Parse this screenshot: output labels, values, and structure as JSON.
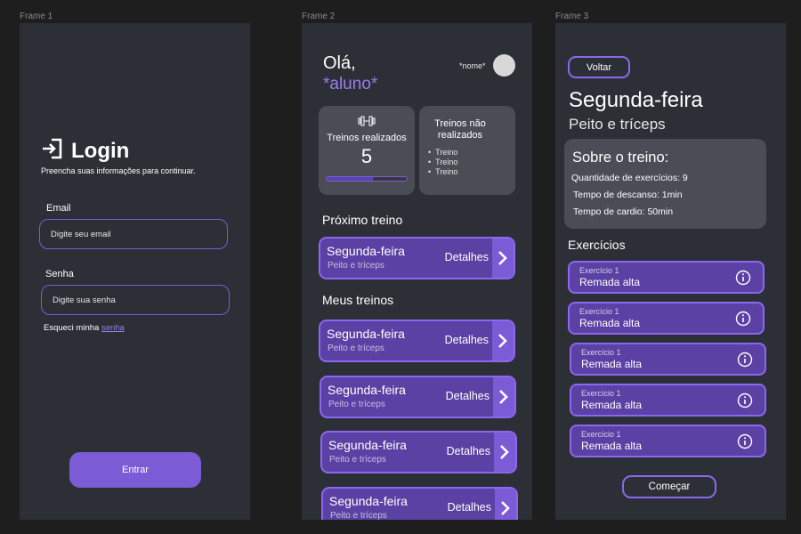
{
  "frames": [
    "Frame 1",
    "Frame 2",
    "Frame 3"
  ],
  "login": {
    "title": "Login",
    "subtitle": "Preencha suas informações para continuar.",
    "email_label": "Email",
    "email_placeholder": "Digite seu email",
    "password_label": "Senha",
    "password_placeholder": "Digite sua senha",
    "forgot_text": "Esqueci minha",
    "forgot_link": "senha",
    "submit": "Entrar"
  },
  "home": {
    "greeting": "Olá,",
    "student": "*aluno*",
    "user_name": "*nome*",
    "done_label": "Treinos realizados",
    "done_count": "5",
    "done_progress": 0.58,
    "missed_label": "Treinos não realizados",
    "missed_items": [
      "Treino",
      "Treino",
      "Treino"
    ],
    "next_title": "Próximo treino",
    "next_workout": {
      "title": "Segunda-feira",
      "subtitle": "Peito e tríceps",
      "action": "Detalhes"
    },
    "my_title": "Meus treinos",
    "workouts": [
      {
        "title": "Segunda-feira",
        "subtitle": "Peito e tríceps",
        "action": "Detalhes"
      },
      {
        "title": "Segunda-feira",
        "subtitle": "Peito e tríceps",
        "action": "Detalhes"
      },
      {
        "title": "Segunda-feira",
        "subtitle": "Peito e tríceps",
        "action": "Detalhes"
      },
      {
        "title": "Segunda-feira",
        "subtitle": "Peito e tríceps",
        "action": "Detalhes"
      }
    ]
  },
  "detail": {
    "back": "Voltar",
    "day": "Segunda-feira",
    "muscles": "Peito e tríceps",
    "about_title": "Sobre o treino:",
    "about_lines": [
      "Quantidade de exercícios: 9",
      "Tempo de descanso: 1min",
      "Tempo de cardio: 50min"
    ],
    "exercises_title": "Exercícios",
    "exercises": [
      {
        "label": "Exercício 1",
        "name": "Remada alta"
      },
      {
        "label": "Exercício 1",
        "name": "Remada alta"
      },
      {
        "label": "Exercício 1",
        "name": "Remada alta"
      },
      {
        "label": "Exercício 1",
        "name": "Remada alta"
      },
      {
        "label": "Exercício 1",
        "name": "Remada alta"
      }
    ],
    "start": "Começar"
  },
  "colors": {
    "background": "#1e1e1e",
    "frame": "#2c2f36",
    "card": "#4a4d55",
    "accent": "#7b5cd6",
    "accent_dark": "#5a41a3",
    "accent_text": "#9b7df0"
  },
  "icons": [
    "login-icon",
    "dumbbell-icon",
    "chevron-right-icon",
    "info-icon"
  ]
}
